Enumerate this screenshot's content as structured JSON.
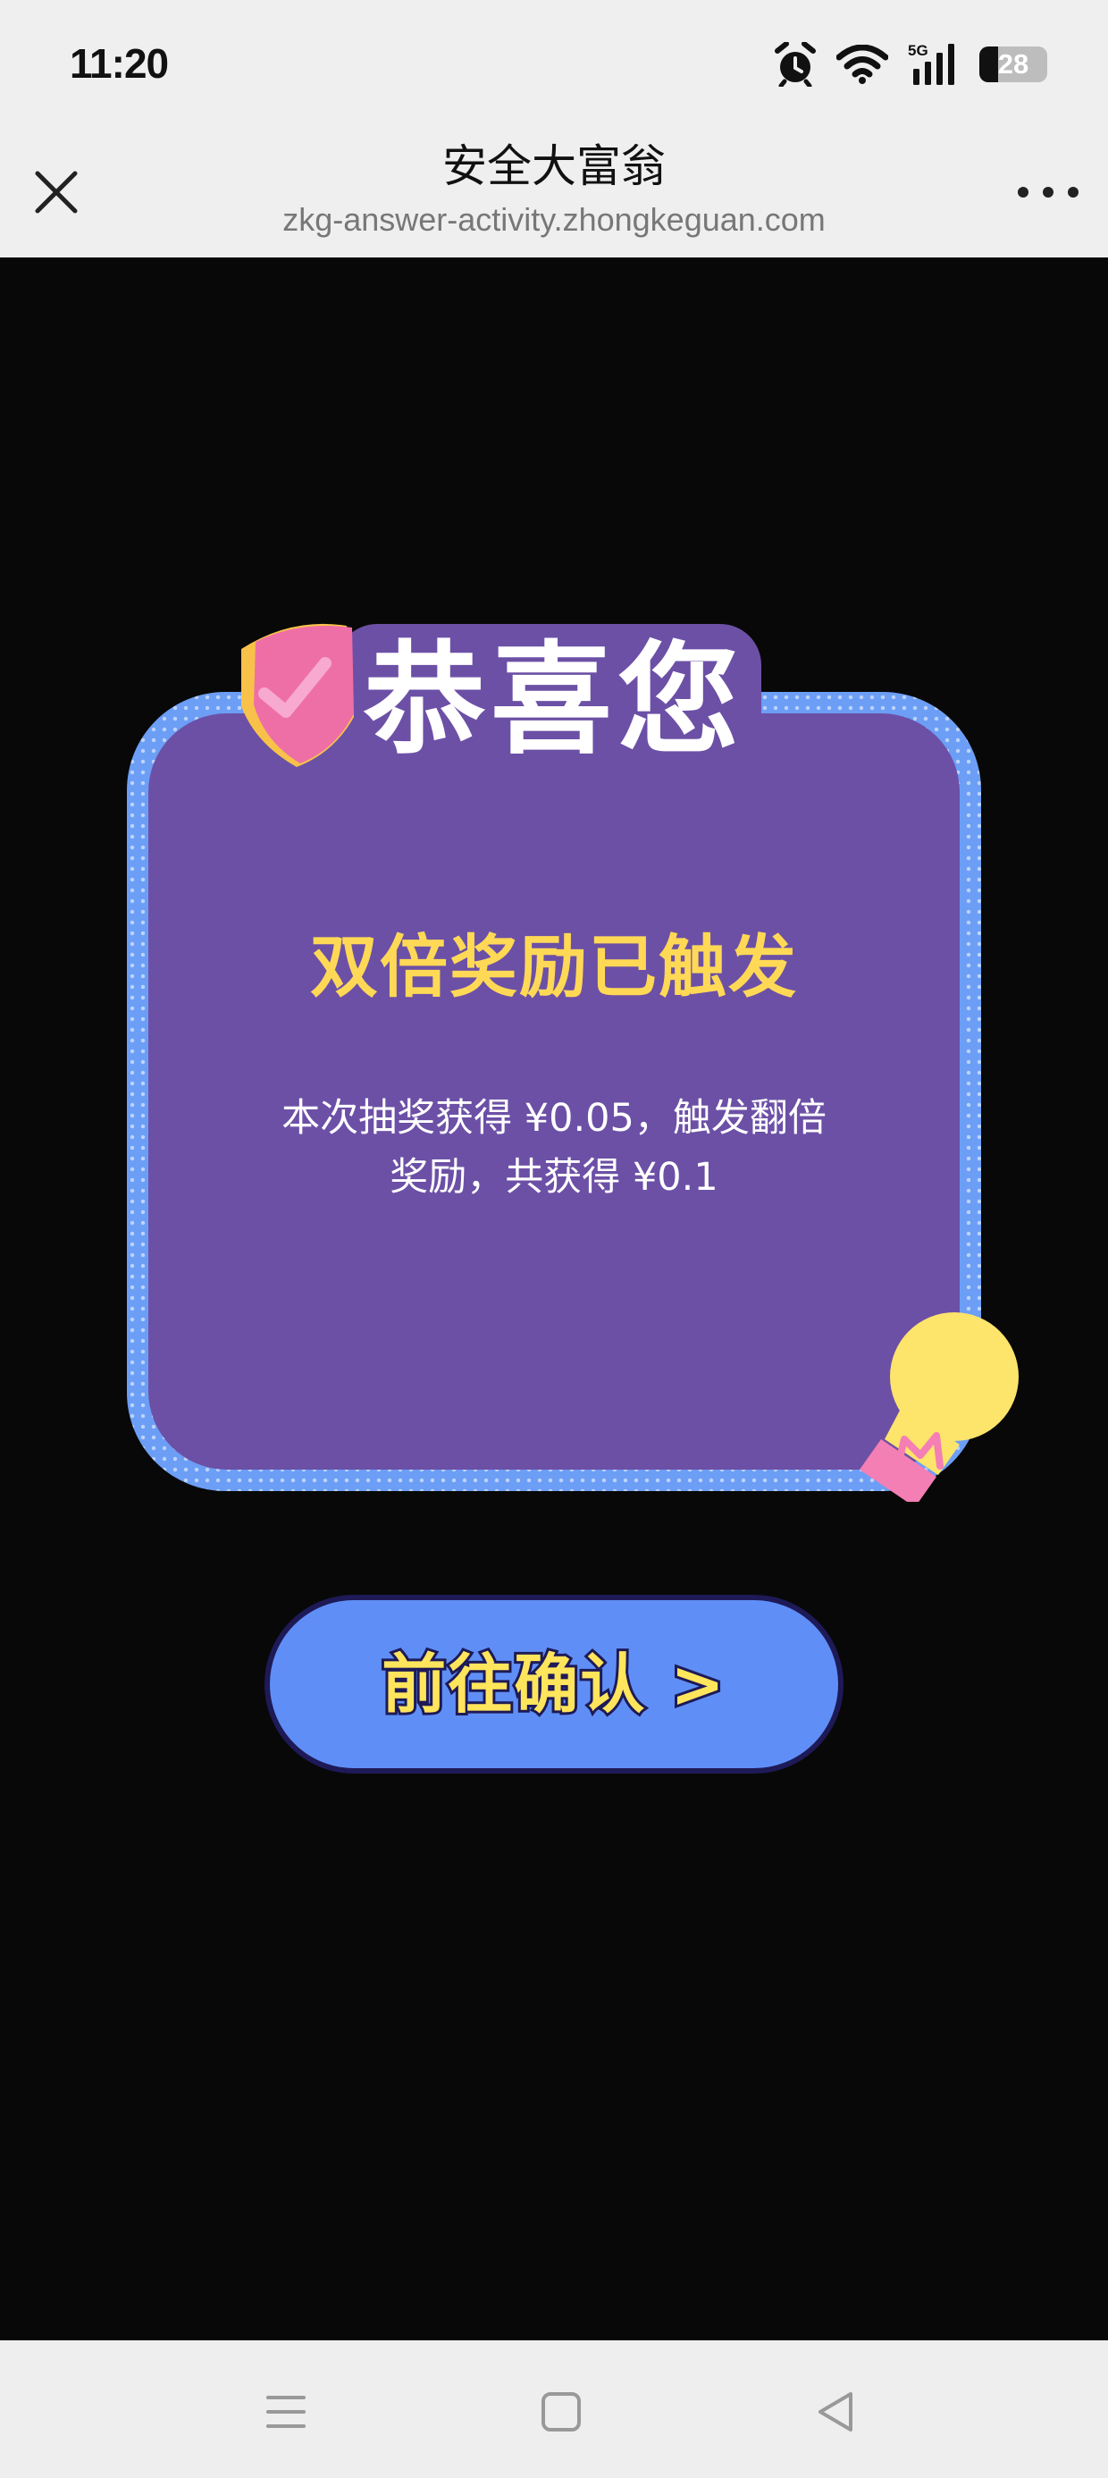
{
  "status_bar": {
    "time": "11:20",
    "network": "5G",
    "battery": "28",
    "battery_level": 0.28
  },
  "browser_header": {
    "title": "安全大富翁",
    "url": "zkg-answer-activity.zhongkeguan.com"
  },
  "reward_card": {
    "badge_text": "恭喜您",
    "title": "双倍奖励已触发",
    "message": "本次抽奖获得 ¥0.05，触发翻倍奖励，共获得 ¥0.1"
  },
  "confirm_button": {
    "label": "前往确认 >"
  },
  "icons": {
    "close": "close-icon",
    "more": "more-icon",
    "alarm": "alarm-icon",
    "wifi": "wifi-icon",
    "signal": "signal-icon",
    "battery": "battery-icon",
    "shield": "shield-check-icon",
    "bulb": "lightbulb-icon",
    "menu": "menu-icon",
    "home": "home-icon",
    "back": "back-icon"
  },
  "colors": {
    "card_background": "#6c50a6",
    "card_border": "#6c9ef6",
    "title_text": "#ffd956",
    "button_background": "#5f8ff6",
    "button_text": "#ffe55c",
    "page_background": "#080808"
  }
}
